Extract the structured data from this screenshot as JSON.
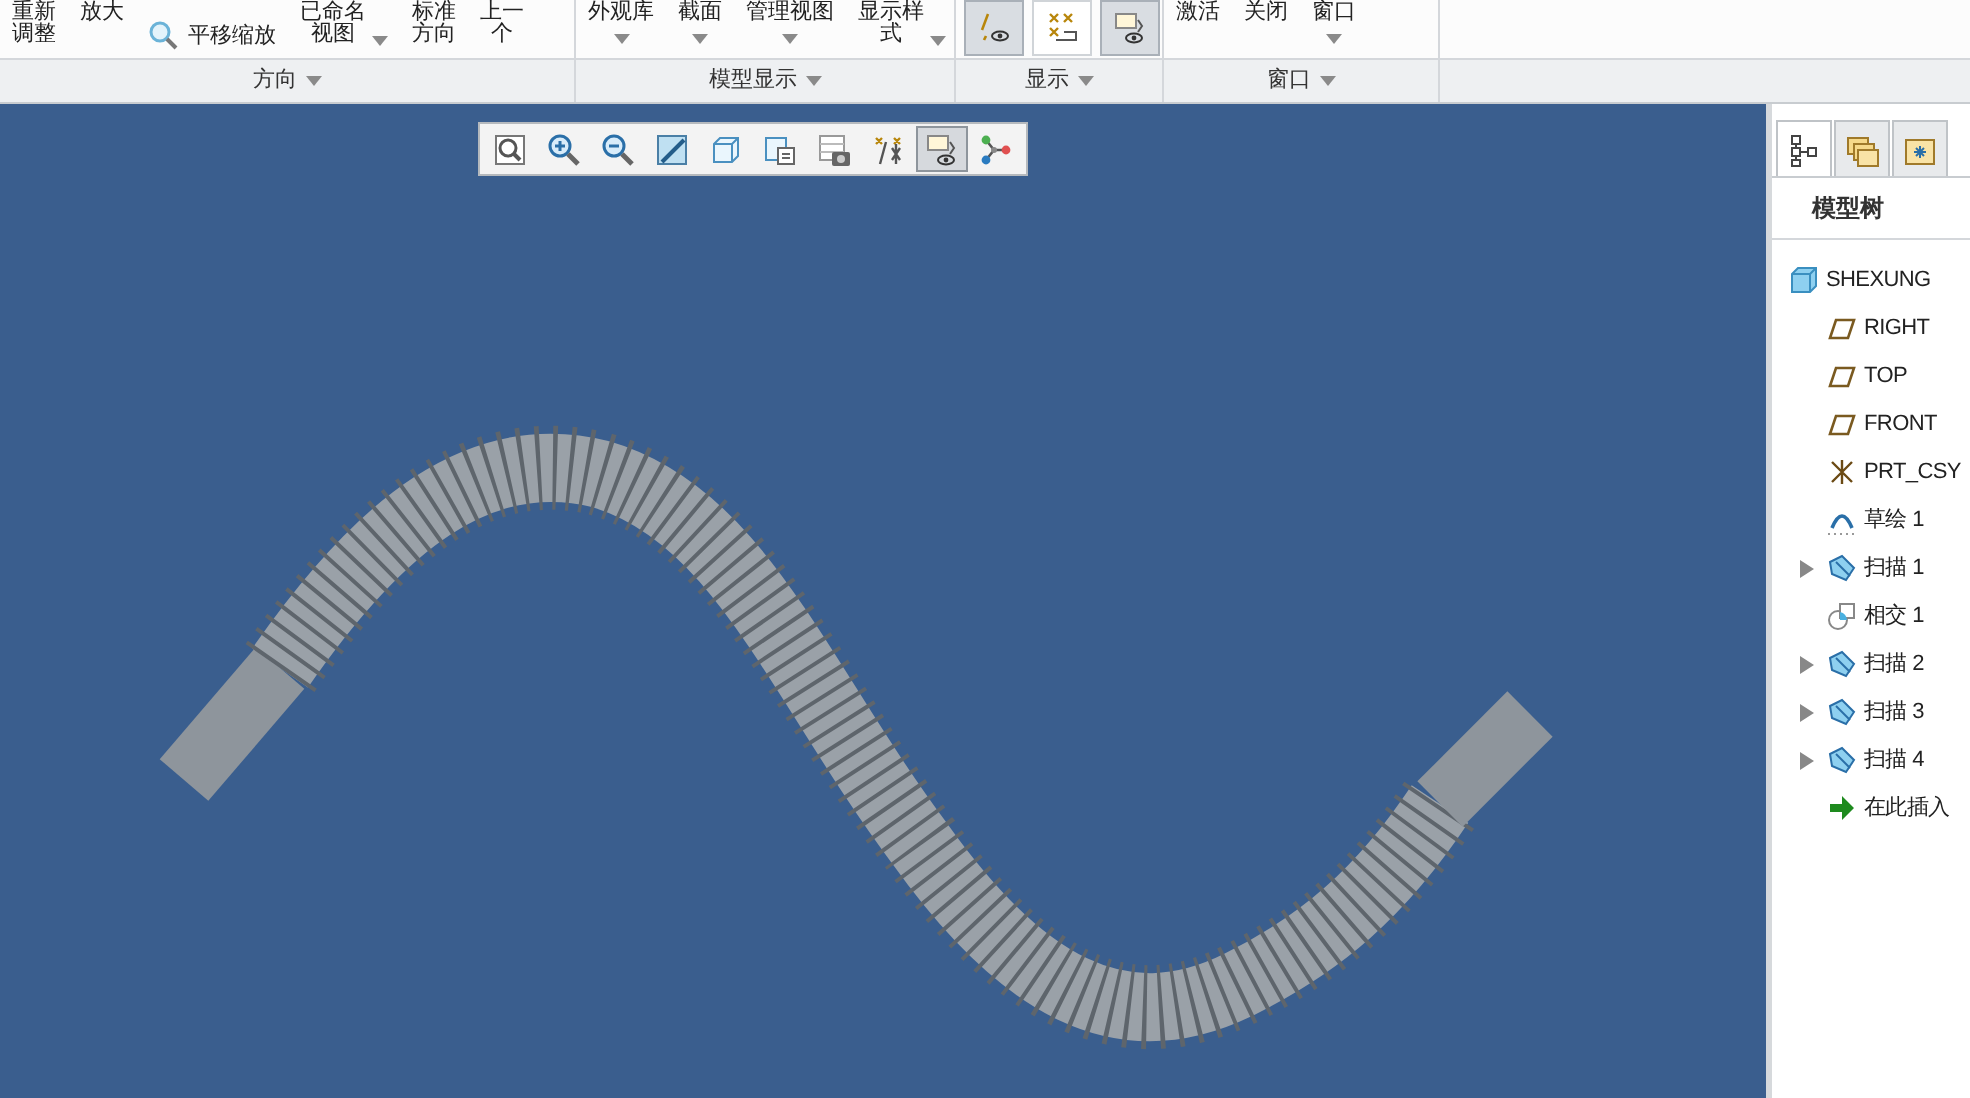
{
  "ribbon": {
    "groups": [
      {
        "label": "方向",
        "items": [
          {
            "kind": "text",
            "lines": [
              "重新",
              "调整"
            ],
            "dropdown": false
          },
          {
            "kind": "text",
            "lines": [
              "放大"
            ],
            "dropdown": false
          },
          {
            "kind": "icon-text",
            "lines": [
              "平移缩放"
            ],
            "dropdown": false
          },
          {
            "kind": "text",
            "lines": [
              "已命名",
              "视图"
            ],
            "dropdown": true
          },
          {
            "kind": "text",
            "lines": [
              "标准",
              "方向"
            ],
            "dropdown": false
          },
          {
            "kind": "text",
            "lines": [
              "上一",
              "个"
            ],
            "dropdown": false
          }
        ]
      },
      {
        "label": "模型显示",
        "items": [
          {
            "kind": "text",
            "lines": [
              "外观库"
            ],
            "dropdown": true
          },
          {
            "kind": "text",
            "lines": [
              "截面"
            ],
            "dropdown": true
          },
          {
            "kind": "text",
            "lines": [
              "管理视图"
            ],
            "dropdown": true
          },
          {
            "kind": "text",
            "lines": [
              "显示样",
              "式"
            ],
            "dropdown": true
          }
        ]
      },
      {
        "label": "显示",
        "items": [
          {
            "kind": "toggle",
            "selected": true
          },
          {
            "kind": "toggle",
            "selected": false
          },
          {
            "kind": "toggle",
            "selected": true
          }
        ]
      },
      {
        "label": "窗口",
        "items": [
          {
            "kind": "text",
            "lines": [
              "激活"
            ],
            "dropdown": false
          },
          {
            "kind": "text",
            "lines": [
              "关闭"
            ],
            "dropdown": false
          },
          {
            "kind": "text",
            "lines": [
              "窗口"
            ],
            "dropdown": true
          }
        ]
      }
    ]
  },
  "view_toolbar": [
    {
      "selected": false
    },
    {
      "selected": false
    },
    {
      "selected": false
    },
    {
      "selected": false
    },
    {
      "selected": false
    },
    {
      "selected": false
    },
    {
      "selected": false
    },
    {
      "selected": false
    },
    {
      "selected": true
    },
    {
      "selected": false
    }
  ],
  "side_panel": {
    "tabs": [
      {
        "selected": true
      },
      {
        "selected": false
      },
      {
        "selected": false
      }
    ],
    "title": "模型树",
    "tree": [
      {
        "kind": "part",
        "label": "SHEXUNG",
        "children": [
          {
            "kind": "plane",
            "label": "RIGHT",
            "expandable": false
          },
          {
            "kind": "plane",
            "label": "TOP",
            "expandable": false
          },
          {
            "kind": "plane",
            "label": "FRONT",
            "expandable": false
          },
          {
            "kind": "csys",
            "label": "PRT_CSY",
            "expandable": false
          },
          {
            "kind": "sketch",
            "label": "草绘 1",
            "expandable": false
          },
          {
            "kind": "sweep",
            "label": "扫描 1",
            "expandable": true
          },
          {
            "kind": "intersect",
            "label": "相交 1",
            "expandable": false
          },
          {
            "kind": "sweep",
            "label": "扫描 2",
            "expandable": true
          },
          {
            "kind": "sweep",
            "label": "扫描 3",
            "expandable": true
          },
          {
            "kind": "sweep",
            "label": "扫描 4",
            "expandable": true
          },
          {
            "kind": "insert",
            "label": "在此插入",
            "expandable": false
          }
        ]
      }
    ]
  }
}
